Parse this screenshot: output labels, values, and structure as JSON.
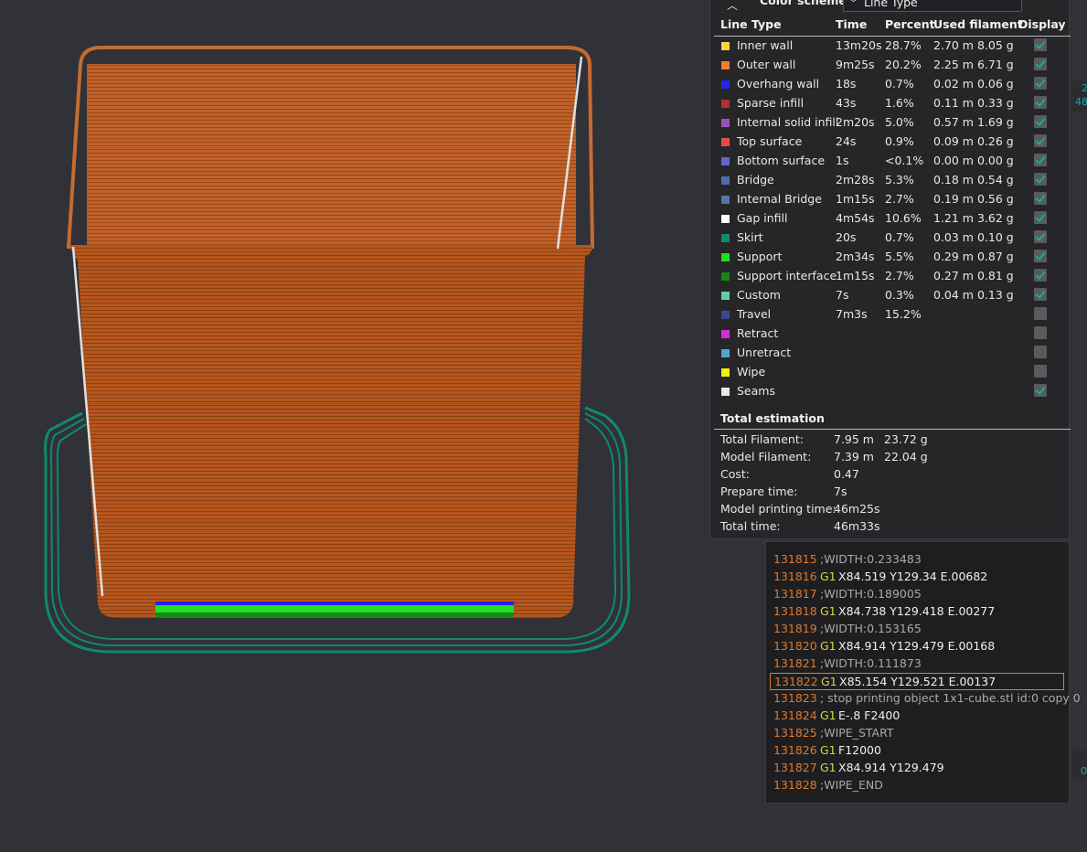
{
  "legend": {
    "scheme_label": "Color scheme",
    "scheme_value": "Line Type",
    "headers": {
      "type": "Line Type",
      "time": "Time",
      "percent": "Percent",
      "filament": "Used filament",
      "display": "Display"
    },
    "rows": [
      {
        "name": "Inner wall",
        "color": "#f5d442",
        "time": "13m20s",
        "percent": "28.7%",
        "length": "2.70 m",
        "weight": "8.05 g",
        "display": true
      },
      {
        "name": "Outer wall",
        "color": "#f57c2b",
        "time": "9m25s",
        "percent": "20.2%",
        "length": "2.25 m",
        "weight": "6.71 g",
        "display": true
      },
      {
        "name": "Overhang wall",
        "color": "#2424ee",
        "time": "18s",
        "percent": "0.7%",
        "length": "0.02 m",
        "weight": "0.06 g",
        "display": true
      },
      {
        "name": "Sparse infill",
        "color": "#b32e2e",
        "time": "43s",
        "percent": "1.6%",
        "length": "0.11 m",
        "weight": "0.33 g",
        "display": true
      },
      {
        "name": "Internal solid infill",
        "color": "#9b4fbf",
        "time": "2m20s",
        "percent": "5.0%",
        "length": "0.57 m",
        "weight": "1.69 g",
        "display": true
      },
      {
        "name": "Top surface",
        "color": "#e84b4b",
        "time": "24s",
        "percent": "0.9%",
        "length": "0.09 m",
        "weight": "0.26 g",
        "display": true
      },
      {
        "name": "Bottom surface",
        "color": "#6464cc",
        "time": "1s",
        "percent": "<0.1%",
        "length": "0.00 m",
        "weight": "0.00 g",
        "display": true
      },
      {
        "name": "Bridge",
        "color": "#4d6ea8",
        "time": "2m28s",
        "percent": "5.3%",
        "length": "0.18 m",
        "weight": "0.54 g",
        "display": true
      },
      {
        "name": "Internal Bridge",
        "color": "#4f78a8",
        "time": "1m15s",
        "percent": "2.7%",
        "length": "0.19 m",
        "weight": "0.56 g",
        "display": true
      },
      {
        "name": "Gap infill",
        "color": "#ffffff",
        "time": "4m54s",
        "percent": "10.6%",
        "length": "1.21 m",
        "weight": "3.62 g",
        "display": true
      },
      {
        "name": "Skirt",
        "color": "#0f8a6e",
        "time": "20s",
        "percent": "0.7%",
        "length": "0.03 m",
        "weight": "0.10 g",
        "display": true
      },
      {
        "name": "Support",
        "color": "#22dd22",
        "time": "2m34s",
        "percent": "5.5%",
        "length": "0.29 m",
        "weight": "0.87 g",
        "display": true
      },
      {
        "name": "Support interface",
        "color": "#138a13",
        "time": "1m15s",
        "percent": "2.7%",
        "length": "0.27 m",
        "weight": "0.81 g",
        "display": true
      },
      {
        "name": "Custom",
        "color": "#5ed1a0",
        "time": "7s",
        "percent": "0.3%",
        "length": "0.04 m",
        "weight": "0.13 g",
        "display": true
      },
      {
        "name": "Travel",
        "color": "#3a4a8c",
        "time": "7m3s",
        "percent": "15.2%",
        "length": "",
        "weight": "",
        "display": false
      },
      {
        "name": "Retract",
        "color": "#d62ed6",
        "time": "",
        "percent": "",
        "length": "",
        "weight": "",
        "display": false
      },
      {
        "name": "Unretract",
        "color": "#4ea8c9",
        "time": "",
        "percent": "",
        "length": "",
        "weight": "",
        "display": false
      },
      {
        "name": "Wipe",
        "color": "#f2f20a",
        "time": "",
        "percent": "",
        "length": "",
        "weight": "",
        "display": false
      },
      {
        "name": "Seams",
        "color": "#e8e8e8",
        "time": "",
        "percent": "",
        "length": "",
        "weight": "",
        "display": true
      }
    ],
    "total": {
      "title": "Total estimation",
      "rows": [
        {
          "label": "Total Filament:",
          "v1": "7.95 m",
          "v2": "23.72 g"
        },
        {
          "label": "Model Filament:",
          "v1": "7.39 m",
          "v2": "22.04 g"
        },
        {
          "label": "Cost:",
          "v1": "0.47",
          "v2": ""
        },
        {
          "label": "Prepare time:",
          "v1": "7s",
          "v2": ""
        },
        {
          "label": "Model printing time:",
          "v1": "46m25s",
          "v2": ""
        },
        {
          "label": "Total time:",
          "v1": "46m33s",
          "v2": ""
        }
      ]
    }
  },
  "gcode": {
    "lines": [
      {
        "num": "131815",
        "cmd": "",
        "text": ";WIDTH:0.233483",
        "selected": false
      },
      {
        "num": "131816",
        "cmd": "G1",
        "text": "X84.519 Y129.34 E.00682",
        "selected": false
      },
      {
        "num": "131817",
        "cmd": "",
        "text": ";WIDTH:0.189005",
        "selected": false
      },
      {
        "num": "131818",
        "cmd": "G1",
        "text": "X84.738 Y129.418 E.00277",
        "selected": false
      },
      {
        "num": "131819",
        "cmd": "",
        "text": ";WIDTH:0.153165",
        "selected": false
      },
      {
        "num": "131820",
        "cmd": "G1",
        "text": "X84.914 Y129.479 E.00168",
        "selected": false
      },
      {
        "num": "131821",
        "cmd": "",
        "text": ";WIDTH:0.111873",
        "selected": false
      },
      {
        "num": "131822",
        "cmd": "G1",
        "text": "X85.154 Y129.521 E.00137",
        "selected": true
      },
      {
        "num": "131823",
        "cmd": "",
        "text": "; stop printing object 1x1-cube.stl id:0 copy 0",
        "selected": false
      },
      {
        "num": "131824",
        "cmd": "G1",
        "text": "E-.8 F2400",
        "selected": false
      },
      {
        "num": "131825",
        "cmd": "",
        "text": ";WIPE_START",
        "selected": false
      },
      {
        "num": "131826",
        "cmd": "G1",
        "text": "F12000",
        "selected": false
      },
      {
        "num": "131827",
        "cmd": "G1",
        "text": "X84.914 Y129.479",
        "selected": false
      },
      {
        "num": "131828",
        "cmd": "",
        "text": ";WIPE_END",
        "selected": false
      }
    ]
  },
  "right_edge": {
    "top_a": "2",
    "top_b": "48",
    "bottom": "0"
  },
  "colors": {
    "model": "#b5561e",
    "skirt": "#0f8a6e",
    "support": "#22dd22",
    "background": "#313138"
  }
}
